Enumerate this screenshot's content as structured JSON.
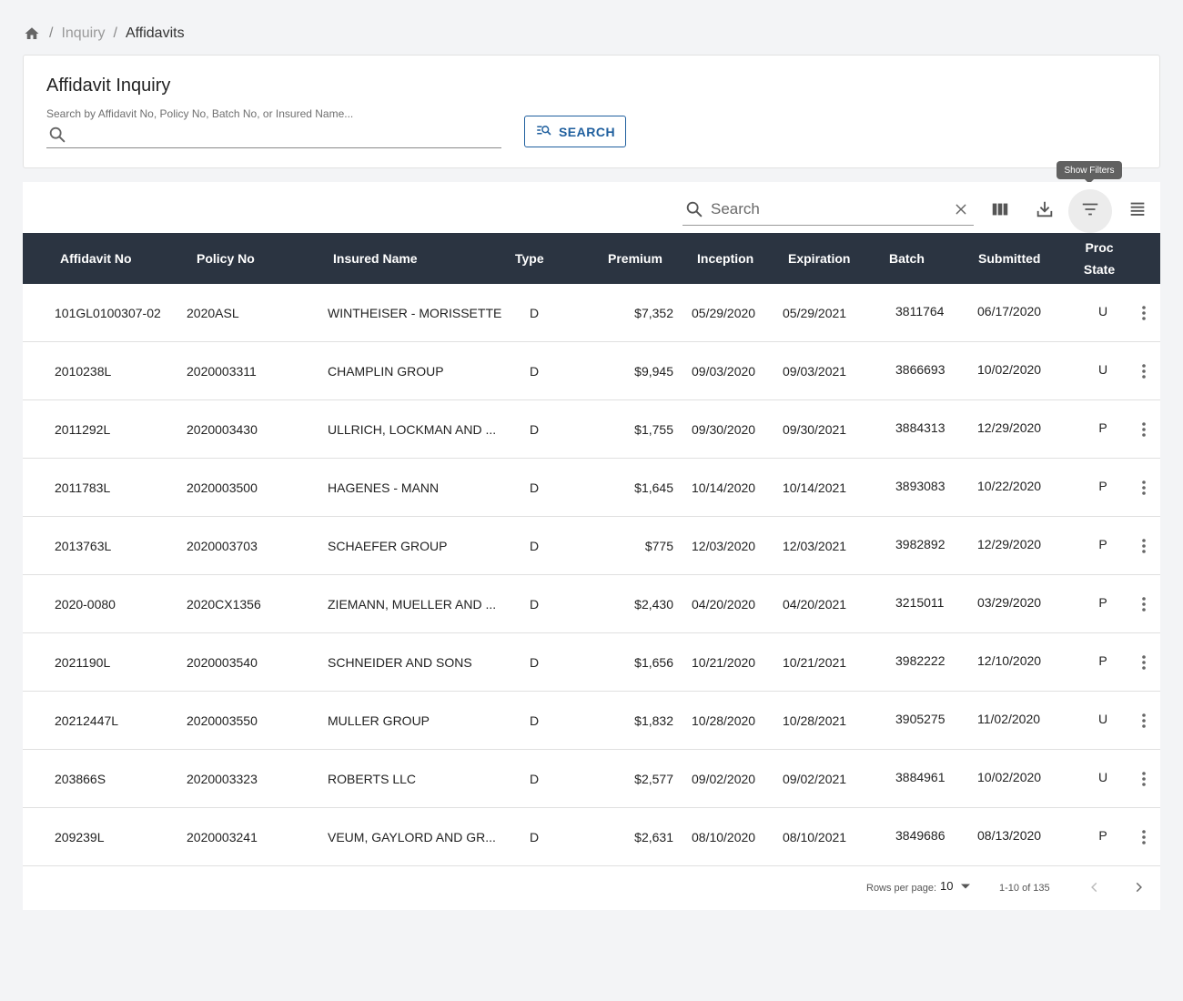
{
  "breadcrumb": {
    "icon": "home-icon",
    "items": [
      {
        "label": "Inquiry"
      },
      {
        "label": "Affidavits"
      }
    ]
  },
  "inquiry": {
    "title": "Affidavit Inquiry",
    "search_label": "Search by Affidavit No, Policy No, Batch No, or Insured Name...",
    "search_value": "",
    "search_button": "SEARCH",
    "search_icon": "search-icon",
    "button_icon": "manage-search-icon"
  },
  "toolbar": {
    "search_placeholder": "Search",
    "search_value": "",
    "tooltip": "Show Filters",
    "icons": [
      "search-icon",
      "close-icon",
      "view-column-icon",
      "download-icon",
      "filter-list-icon",
      "view-headline-icon"
    ]
  },
  "table": {
    "columns": {
      "affidavit_no": "Affidavit No",
      "policy_no": "Policy No",
      "insured_name": "Insured Name",
      "type": "Type",
      "premium": "Premium",
      "inception": "Inception",
      "expiration": "Expiration",
      "batch": "Batch",
      "submitted": "Submitted",
      "proc_line1": "Proc",
      "proc_line2": "State"
    },
    "rows": [
      {
        "affidavit": "101GL0100307-02",
        "policy": "2020ASL",
        "insured": "WINTHEISER - MORISSETTE",
        "type": "D",
        "premium": "$7,352",
        "inception": "05/29/2020",
        "expiration": "05/29/2021",
        "batch": "3811764",
        "submitted": "06/17/2020",
        "state": "U"
      },
      {
        "affidavit": "2010238L",
        "policy": "2020003311",
        "insured": "CHAMPLIN GROUP",
        "type": "D",
        "premium": "$9,945",
        "inception": "09/03/2020",
        "expiration": "09/03/2021",
        "batch": "3866693",
        "submitted": "10/02/2020",
        "state": "U"
      },
      {
        "affidavit": "2011292L",
        "policy": "2020003430",
        "insured": "ULLRICH, LOCKMAN AND ...",
        "type": "D",
        "premium": "$1,755",
        "inception": "09/30/2020",
        "expiration": "09/30/2021",
        "batch": "3884313",
        "submitted": "12/29/2020",
        "state": "P"
      },
      {
        "affidavit": "2011783L",
        "policy": "2020003500",
        "insured": "HAGENES - MANN",
        "type": "D",
        "premium": "$1,645",
        "inception": "10/14/2020",
        "expiration": "10/14/2021",
        "batch": "3893083",
        "submitted": "10/22/2020",
        "state": "P"
      },
      {
        "affidavit": "2013763L",
        "policy": "2020003703",
        "insured": "SCHAEFER GROUP",
        "type": "D",
        "premium": "$775",
        "inception": "12/03/2020",
        "expiration": "12/03/2021",
        "batch": "3982892",
        "submitted": "12/29/2020",
        "state": "P"
      },
      {
        "affidavit": "2020-0080",
        "policy": "2020CX1356",
        "insured": "ZIEMANN, MUELLER AND ...",
        "type": "D",
        "premium": "$2,430",
        "inception": "04/20/2020",
        "expiration": "04/20/2021",
        "batch": "3215011",
        "submitted": "03/29/2020",
        "state": "P"
      },
      {
        "affidavit": "2021190L",
        "policy": "2020003540",
        "insured": "SCHNEIDER AND SONS",
        "type": "D",
        "premium": "$1,656",
        "inception": "10/21/2020",
        "expiration": "10/21/2021",
        "batch": "3982222",
        "submitted": "12/10/2020",
        "state": "P"
      },
      {
        "affidavit": "20212447L",
        "policy": "2020003550",
        "insured": "MULLER GROUP",
        "type": "D",
        "premium": "$1,832",
        "inception": "10/28/2020",
        "expiration": "10/28/2021",
        "batch": "3905275",
        "submitted": "11/02/2020",
        "state": "U"
      },
      {
        "affidavit": "203866S",
        "policy": "2020003323",
        "insured": "ROBERTS LLC",
        "type": "D",
        "premium": "$2,577",
        "inception": "09/02/2020",
        "expiration": "09/02/2021",
        "batch": "3884961",
        "submitted": "10/02/2020",
        "state": "U"
      },
      {
        "affidavit": "209239L",
        "policy": "2020003241",
        "insured": "VEUM, GAYLORD AND GR...",
        "type": "D",
        "premium": "$2,631",
        "inception": "08/10/2020",
        "expiration": "08/10/2021",
        "batch": "3849686",
        "submitted": "08/13/2020",
        "state": "P"
      }
    ]
  },
  "pagination": {
    "rows_label": "Rows per page:",
    "rows_value": "10",
    "range": "1-10 of 135"
  },
  "colors": {
    "header_bg": "#2b3441",
    "accent": "#1f5f9e"
  }
}
